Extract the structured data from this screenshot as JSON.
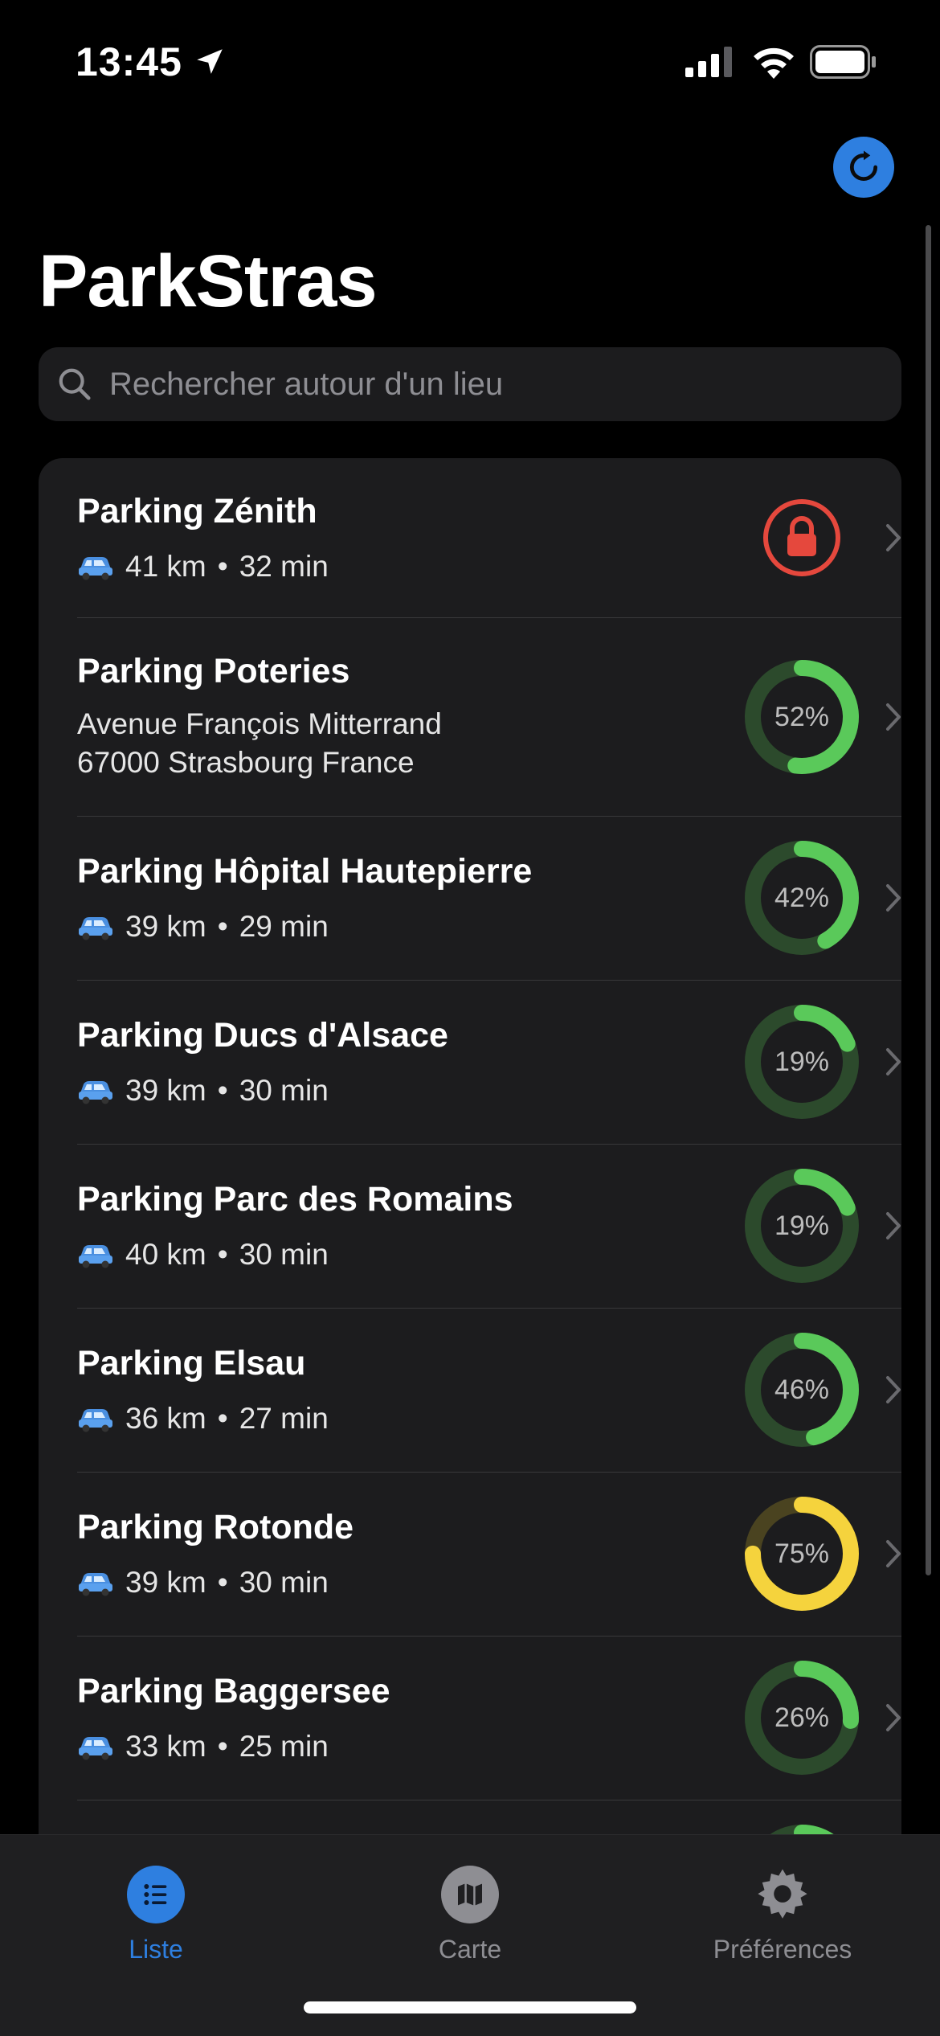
{
  "status": {
    "time": "13:45"
  },
  "app": {
    "title": "ParkStras"
  },
  "search": {
    "placeholder": "Rechercher autour d'un lieu"
  },
  "parkings": [
    {
      "name": "Parking Zénith",
      "distance": "41 km",
      "duration": "32 min",
      "closed": true
    },
    {
      "name": "Parking Poteries",
      "address_line1": "Avenue François Mitterrand",
      "address_line2": "67000 Strasbourg France",
      "occupancy_label": "52%",
      "occupancy": 52,
      "color": "#5ac95a"
    },
    {
      "name": "Parking Hôpital Hautepierre",
      "distance": "39 km",
      "duration": "29 min",
      "occupancy_label": "42%",
      "occupancy": 42,
      "color": "#5ac95a"
    },
    {
      "name": "Parking Ducs d'Alsace",
      "distance": "39 km",
      "duration": "30 min",
      "occupancy_label": "19%",
      "occupancy": 19,
      "color": "#5ac95a"
    },
    {
      "name": "Parking Parc des Romains",
      "distance": "40 km",
      "duration": "30 min",
      "occupancy_label": "19%",
      "occupancy": 19,
      "color": "#5ac95a"
    },
    {
      "name": "Parking Elsau",
      "distance": "36 km",
      "duration": "27 min",
      "occupancy_label": "46%",
      "occupancy": 46,
      "color": "#5ac95a"
    },
    {
      "name": "Parking Rotonde",
      "distance": "39 km",
      "duration": "30 min",
      "occupancy_label": "75%",
      "occupancy": 75,
      "color": "#f5d33d"
    },
    {
      "name": "Parking Baggersee",
      "distance": "33 km",
      "duration": "25 min",
      "occupancy_label": "26%",
      "occupancy": 26,
      "color": "#5ac95a"
    }
  ],
  "tabs": [
    {
      "label": "Liste",
      "icon": "list-icon",
      "active": true
    },
    {
      "label": "Carte",
      "icon": "map-icon",
      "active": false
    },
    {
      "label": "Préférences",
      "icon": "gear-icon",
      "active": false
    }
  ],
  "colors": {
    "accent": "#2e7fe0",
    "available": "#5ac95a",
    "warning": "#f5d33d",
    "closed": "#e5483d"
  }
}
